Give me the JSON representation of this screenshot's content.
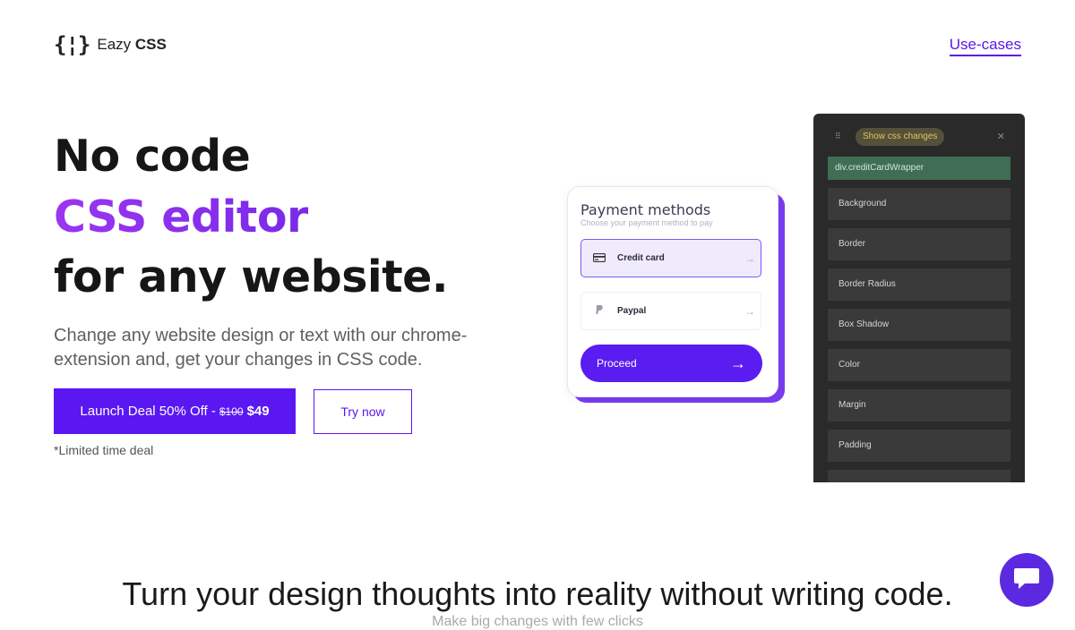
{
  "header": {
    "logo_mark": "{¦}",
    "logo_text_light": "Eazy",
    "logo_text_bold": "CSS",
    "nav_link": "Use-cases"
  },
  "hero": {
    "line1": "No code",
    "line2": "CSS editor",
    "line3": "for any website.",
    "subtitle": "Change any website design or text with our chrome-extension and, get your changes in CSS code.",
    "primary_button_label": "Launch Deal 50% Off -",
    "primary_button_old_price": "$100",
    "primary_button_price": "$49",
    "secondary_button_label": "Try now",
    "note": "*Limited time deal"
  },
  "payment_card": {
    "title": "Payment methods",
    "subtitle": "Choose your payment method to pay",
    "options": [
      {
        "label": "Credit card",
        "icon": "credit-card-icon",
        "selected": true
      },
      {
        "label": "Paypal",
        "icon": "paypal-icon",
        "selected": false
      }
    ],
    "proceed_label": "Proceed"
  },
  "css_panel": {
    "badge": "Show css changes",
    "selector": "div.creditCardWrapper",
    "properties": [
      "Background",
      "Border",
      "Border Radius",
      "Box Shadow",
      "Color",
      "Margin",
      "Padding"
    ]
  },
  "section2": {
    "title": "Turn your design thoughts into reality without writing code.",
    "subtitle": "Make big changes with few clicks"
  },
  "colors": {
    "accent": "#5a17f2",
    "gradient_start": "#9b35f2",
    "panel_bg": "#2a2a2a"
  }
}
